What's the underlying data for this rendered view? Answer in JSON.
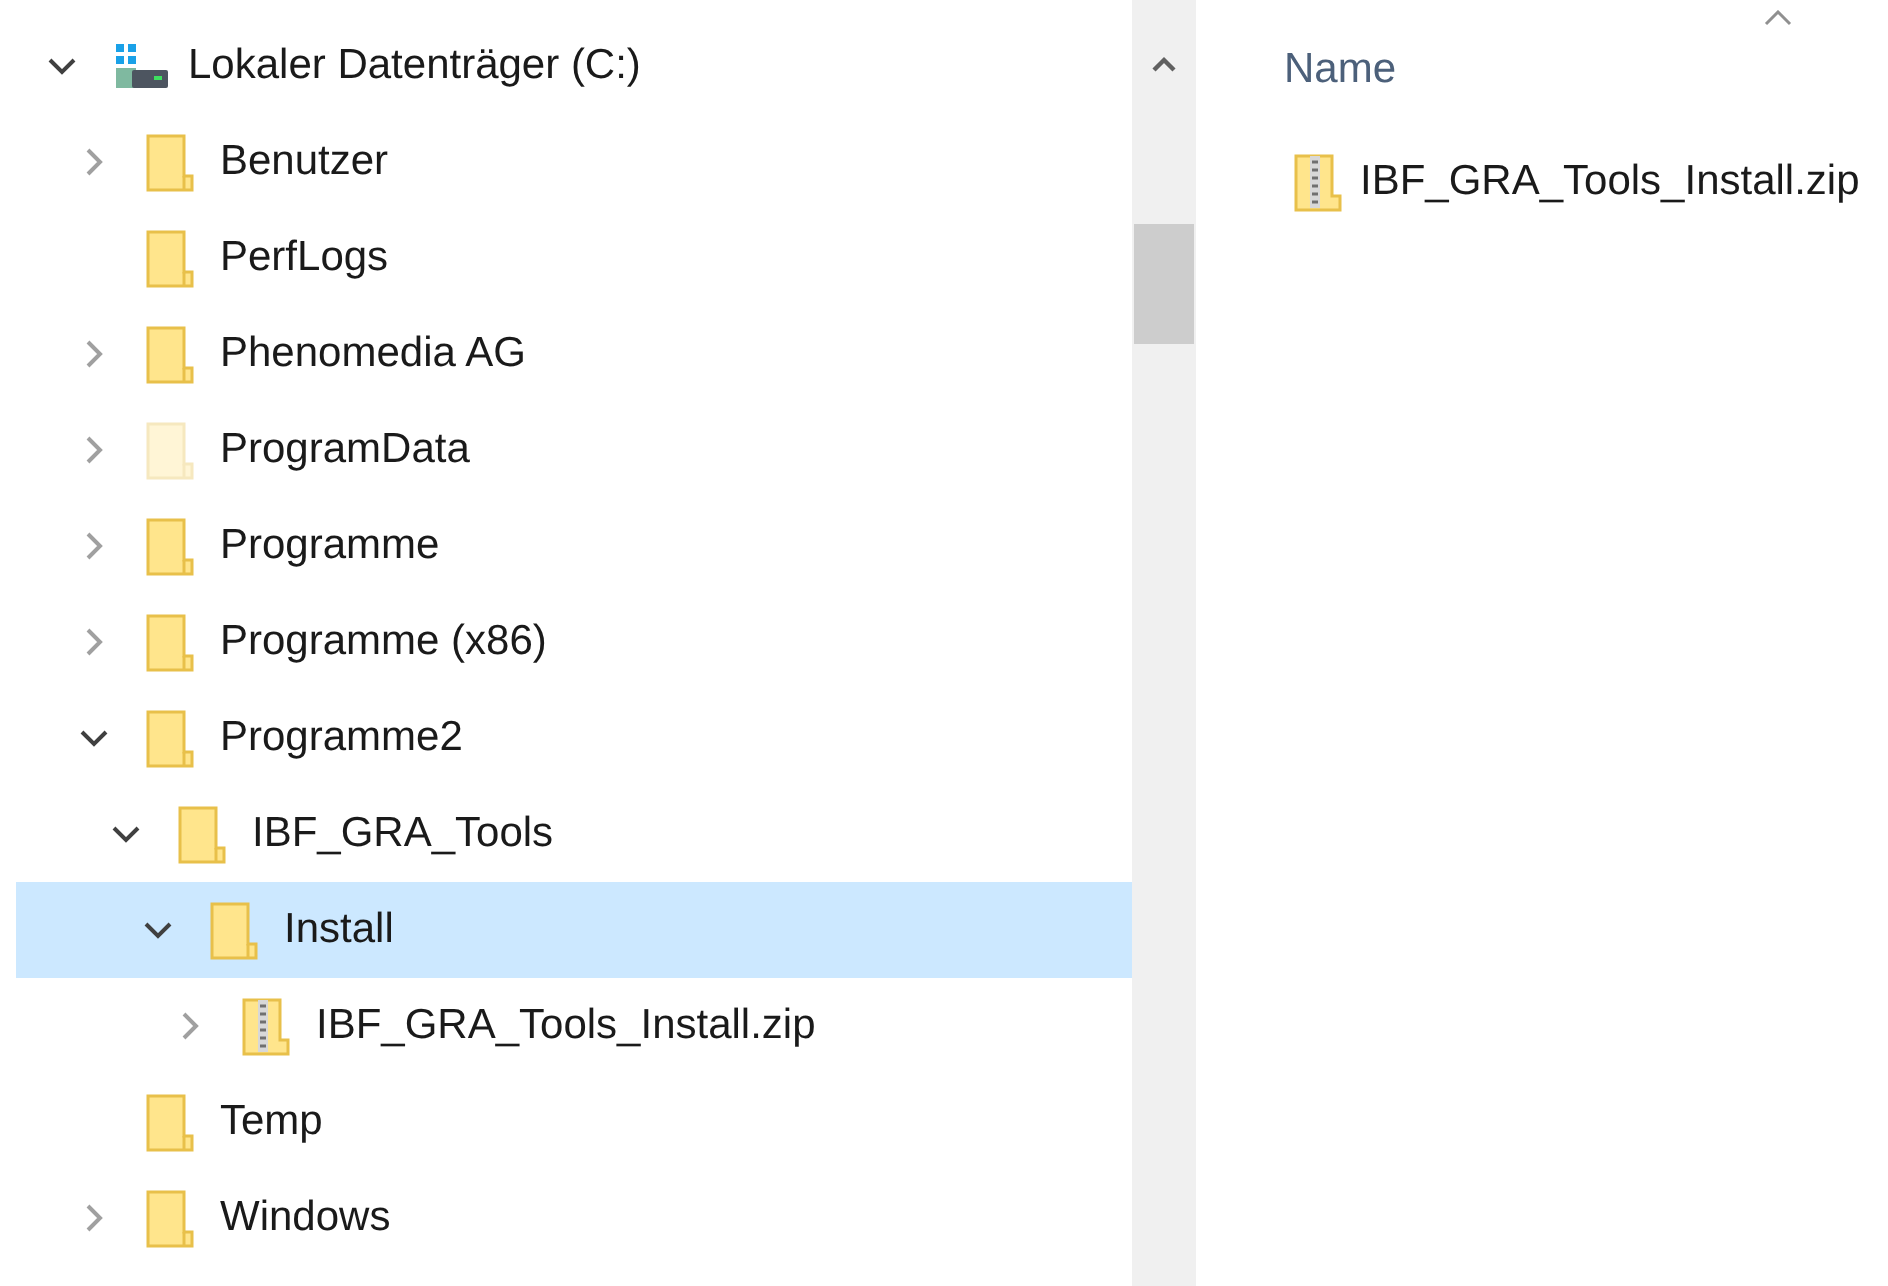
{
  "tree": [
    {
      "label": "Lokaler Datenträger (C:)",
      "kind": "drive",
      "expandable": true,
      "expanded": true,
      "selected": false,
      "hidden": false,
      "children": [
        {
          "label": "Benutzer",
          "kind": "folder",
          "expandable": true,
          "expanded": false,
          "selected": false,
          "hidden": false
        },
        {
          "label": "PerfLogs",
          "kind": "folder",
          "expandable": false,
          "selected": false,
          "hidden": false
        },
        {
          "label": "Phenomedia AG",
          "kind": "folder",
          "expandable": true,
          "expanded": false,
          "selected": false,
          "hidden": false
        },
        {
          "label": "ProgramData",
          "kind": "folder",
          "expandable": true,
          "expanded": false,
          "selected": false,
          "hidden": true
        },
        {
          "label": "Programme",
          "kind": "folder",
          "expandable": true,
          "expanded": false,
          "selected": false,
          "hidden": false
        },
        {
          "label": "Programme (x86)",
          "kind": "folder",
          "expandable": true,
          "expanded": false,
          "selected": false,
          "hidden": false
        },
        {
          "label": "Programme2",
          "kind": "folder",
          "expandable": true,
          "expanded": true,
          "selected": false,
          "hidden": false,
          "children": [
            {
              "label": "IBF_GRA_Tools",
              "kind": "folder",
              "expandable": true,
              "expanded": true,
              "selected": false,
              "hidden": false,
              "children": [
                {
                  "label": "Install",
                  "kind": "folder",
                  "expandable": true,
                  "expanded": true,
                  "selected": true,
                  "hidden": false,
                  "children": [
                    {
                      "label": "IBF_GRA_Tools_Install.zip",
                      "kind": "zip",
                      "expandable": true,
                      "expanded": false,
                      "selected": false,
                      "hidden": false
                    }
                  ]
                }
              ]
            }
          ]
        },
        {
          "label": "Temp",
          "kind": "folder",
          "expandable": false,
          "selected": false,
          "hidden": false
        },
        {
          "label": "Windows",
          "kind": "folder",
          "expandable": true,
          "expanded": false,
          "selected": false,
          "hidden": false
        }
      ]
    }
  ],
  "file_list": {
    "columns": [
      {
        "label": "Name",
        "sorted": true
      }
    ],
    "items": [
      {
        "label": "IBF_GRA_Tools_Install.zip",
        "kind": "zip"
      }
    ]
  }
}
